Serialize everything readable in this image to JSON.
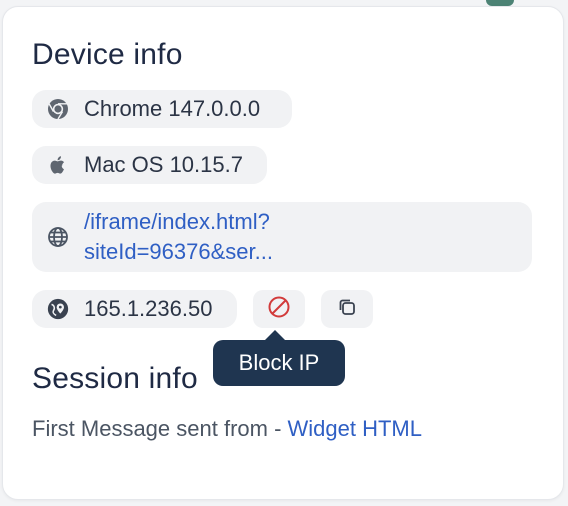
{
  "device_info": {
    "title": "Device info",
    "browser": {
      "label": "Chrome 147.0.0.0",
      "icon": "chrome-icon"
    },
    "os": {
      "label": "Mac OS 10.15.7",
      "icon": "apple-icon"
    },
    "url": {
      "line1": "/iframe/index.html?",
      "line2": "siteId=96376&ser...",
      "icon": "globe-icon"
    },
    "ip": {
      "label": "165.1.236.50",
      "icon": "globe-pin-icon"
    },
    "block_button": {
      "icon": "block-icon"
    },
    "copy_button": {
      "icon": "copy-icon"
    },
    "tooltip": "Block IP"
  },
  "session_info": {
    "title": "Session info",
    "first_message_prefix": "First Message sent from - ",
    "first_message_link": "Widget HTML"
  },
  "colors": {
    "title": "#1f2a44",
    "link": "#2f5fc4",
    "chip_bg": "#f1f2f4",
    "tooltip_bg": "#1f3550",
    "block_red": "#d23b3b"
  }
}
